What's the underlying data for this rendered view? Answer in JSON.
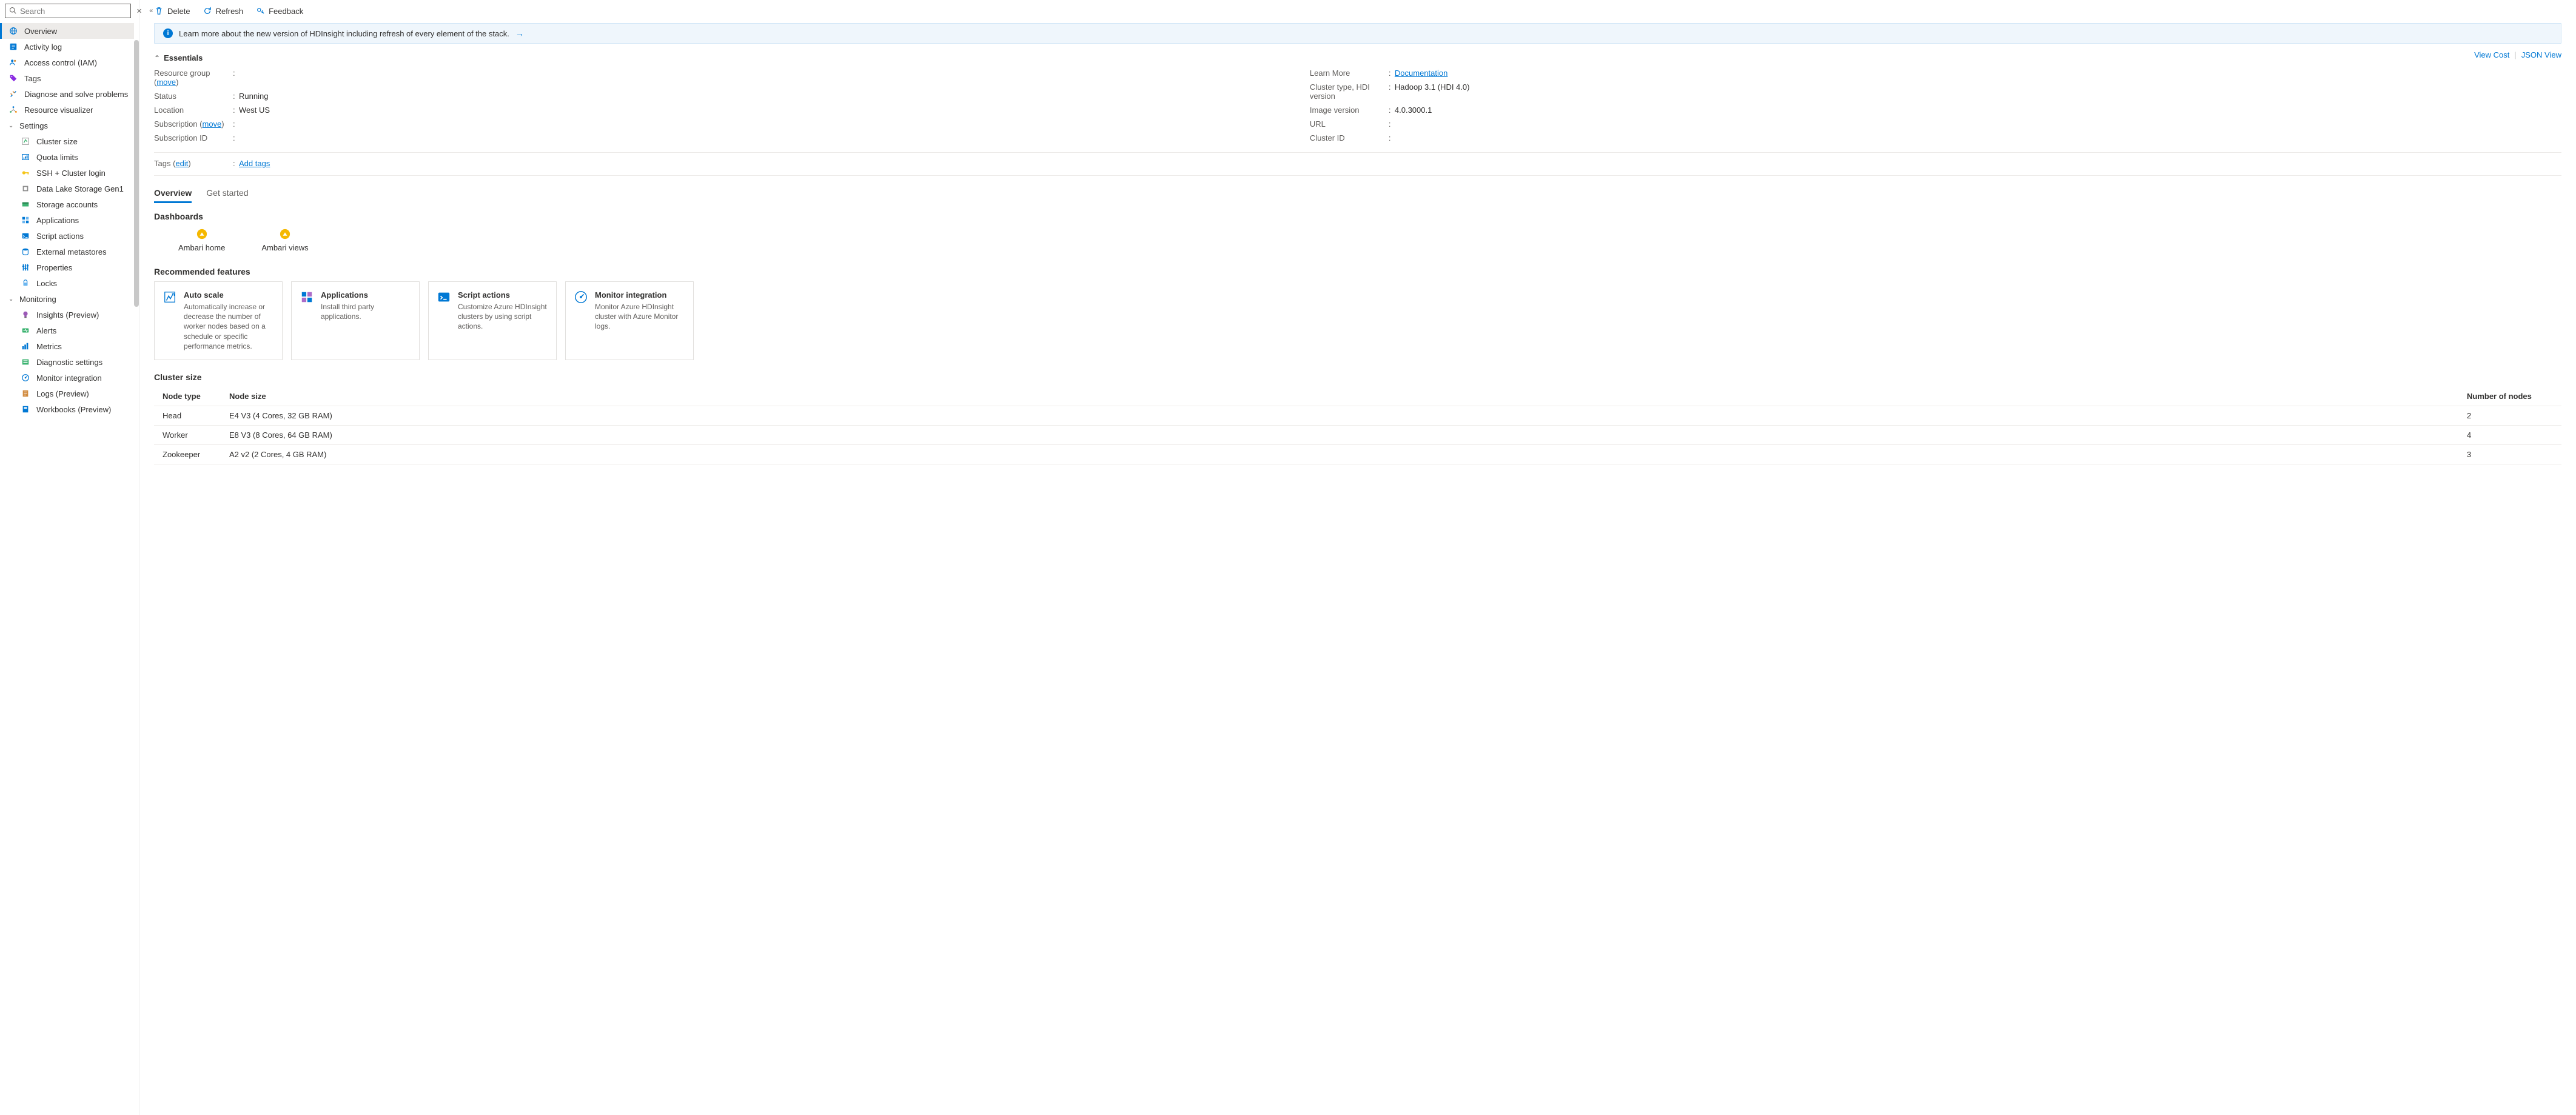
{
  "search": {
    "placeholder": "Search"
  },
  "sidebar": {
    "top": [
      {
        "label": "Overview",
        "icon": "globe",
        "active": true
      },
      {
        "label": "Activity log",
        "icon": "activity"
      },
      {
        "label": "Access control (IAM)",
        "icon": "people"
      },
      {
        "label": "Tags",
        "icon": "tag"
      },
      {
        "label": "Diagnose and solve problems",
        "icon": "tools"
      },
      {
        "label": "Resource visualizer",
        "icon": "visual"
      }
    ],
    "settings_label": "Settings",
    "settings": [
      {
        "label": "Cluster size",
        "icon": "scale"
      },
      {
        "label": "Quota limits",
        "icon": "quota"
      },
      {
        "label": "SSH + Cluster login",
        "icon": "key"
      },
      {
        "label": "Data Lake Storage Gen1",
        "icon": "datalake"
      },
      {
        "label": "Storage accounts",
        "icon": "storage"
      },
      {
        "label": "Applications",
        "icon": "apps"
      },
      {
        "label": "Script actions",
        "icon": "script"
      },
      {
        "label": "External metastores",
        "icon": "metastore"
      },
      {
        "label": "Properties",
        "icon": "props"
      },
      {
        "label": "Locks",
        "icon": "lock"
      }
    ],
    "monitoring_label": "Monitoring",
    "monitoring": [
      {
        "label": "Insights (Preview)",
        "icon": "insights"
      },
      {
        "label": "Alerts",
        "icon": "alerts"
      },
      {
        "label": "Metrics",
        "icon": "metrics"
      },
      {
        "label": "Diagnostic settings",
        "icon": "diag"
      },
      {
        "label": "Monitor integration",
        "icon": "monitor"
      },
      {
        "label": "Logs (Preview)",
        "icon": "logs"
      },
      {
        "label": "Workbooks (Preview)",
        "icon": "workbook"
      }
    ]
  },
  "toolbar": {
    "delete": "Delete",
    "refresh": "Refresh",
    "feedback": "Feedback"
  },
  "banner": {
    "text": "Learn more about the new version of HDInsight including refresh of every element of the stack."
  },
  "essentials_title": "Essentials",
  "view_cost": "View Cost",
  "json_view": "JSON View",
  "essentials": {
    "left": [
      {
        "label": "Resource group",
        "move": "move",
        "val": ""
      },
      {
        "label": "Status",
        "val": "Running"
      },
      {
        "label": "Location",
        "val": "West US"
      },
      {
        "label": "Subscription",
        "move": "move",
        "val": ""
      },
      {
        "label": "Subscription ID",
        "val": ""
      }
    ],
    "right": [
      {
        "label": "Learn More",
        "link": "Documentation"
      },
      {
        "label": "Cluster type, HDI version",
        "val": "Hadoop 3.1 (HDI 4.0)"
      },
      {
        "label": "Image version",
        "val": "4.0.3000.1"
      },
      {
        "label": "URL",
        "val": ""
      },
      {
        "label": "Cluster ID",
        "val": ""
      }
    ]
  },
  "tags": {
    "label": "Tags",
    "edit": "edit",
    "add": "Add tags"
  },
  "tabs": {
    "overview": "Overview",
    "getstarted": "Get started"
  },
  "sections": {
    "dashboards": "Dashboards",
    "recommended": "Recommended features",
    "cluster": "Cluster size"
  },
  "dashboards": [
    {
      "label": "Ambari home"
    },
    {
      "label": "Ambari views"
    }
  ],
  "recommended": [
    {
      "title": "Auto scale",
      "desc": "Automatically increase or decrease the number of worker nodes based on a schedule or specific performance metrics.",
      "icon": "autoscale"
    },
    {
      "title": "Applications",
      "desc": "Install third party applications.",
      "icon": "apps-card"
    },
    {
      "title": "Script actions",
      "desc": "Customize Azure HDInsight clusters by using script actions.",
      "icon": "terminal"
    },
    {
      "title": "Monitor integration",
      "desc": "Monitor Azure HDInsight cluster with Azure Monitor logs.",
      "icon": "gauge"
    }
  ],
  "cluster_table": {
    "headers": {
      "type": "Node type",
      "size": "Node size",
      "count": "Number of nodes"
    },
    "rows": [
      {
        "type": "Head",
        "size": "E4 V3 (4 Cores, 32 GB RAM)",
        "count": "2"
      },
      {
        "type": "Worker",
        "size": "E8 V3 (8 Cores, 64 GB RAM)",
        "count": "4"
      },
      {
        "type": "Zookeeper",
        "size": "A2 v2 (2 Cores, 4 GB RAM)",
        "count": "3"
      }
    ]
  }
}
